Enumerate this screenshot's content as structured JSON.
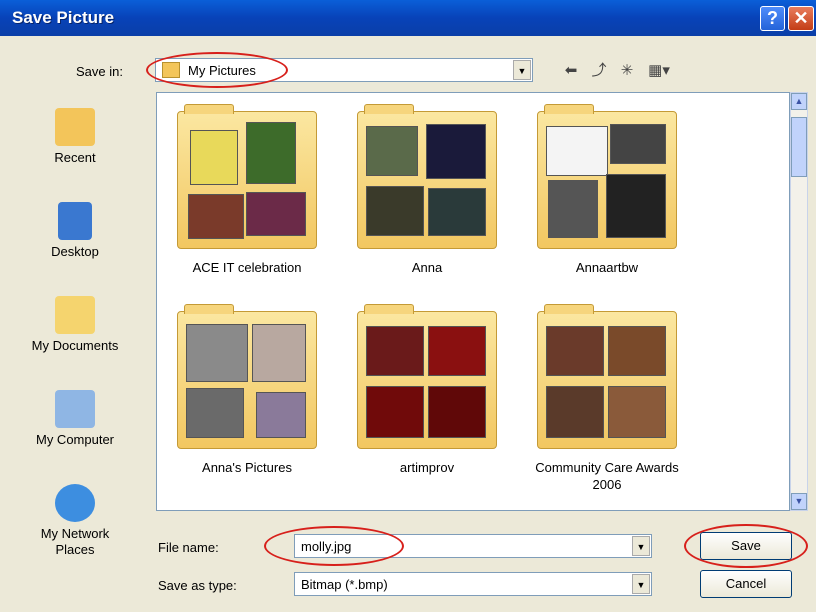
{
  "window": {
    "title": "Save Picture",
    "help_glyph": "?",
    "close_glyph": "✕"
  },
  "save_in": {
    "label": "Save in:",
    "value": "My Pictures"
  },
  "places": [
    {
      "label": "Recent"
    },
    {
      "label": "Desktop"
    },
    {
      "label": "My Documents"
    },
    {
      "label": "My Computer"
    },
    {
      "label": "My Network Places"
    }
  ],
  "folders": [
    {
      "name": "ACE IT celebration"
    },
    {
      "name": "Anna"
    },
    {
      "name": "Annaartbw"
    },
    {
      "name": "Anna's Pictures"
    },
    {
      "name": "artimprov"
    },
    {
      "name": "Community Care Awards 2006"
    }
  ],
  "file_name": {
    "label": "File name:",
    "value": "molly.jpg"
  },
  "save_as_type": {
    "label": "Save as type:",
    "value": "Bitmap (*.bmp)"
  },
  "buttons": {
    "save": "Save",
    "cancel": "Cancel"
  },
  "colors": {
    "title_bar": "#0842b8",
    "highlight_circle": "#d7201b",
    "folder": "#f2c761"
  }
}
